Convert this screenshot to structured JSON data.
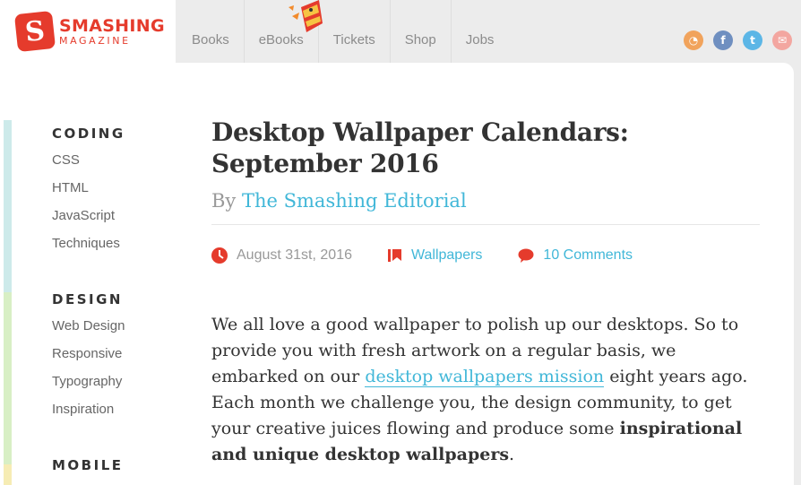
{
  "header": {
    "logo_title": "SMASHING",
    "logo_subtitle": "MAGAZINE",
    "logo_mark": "S",
    "nav": [
      "Books",
      "eBooks",
      "Tickets",
      "Shop",
      "Jobs"
    ],
    "social": [
      {
        "name": "rss-icon",
        "color": "#f1a35c",
        "glyph": "◔"
      },
      {
        "name": "facebook-icon",
        "color": "#6f8fc0",
        "glyph": "f"
      },
      {
        "name": "twitter-icon",
        "color": "#5cb6e6",
        "glyph": "t"
      },
      {
        "name": "newsletter-icon",
        "color": "#f3a6a0",
        "glyph": "✉"
      }
    ]
  },
  "sidebar": {
    "coding": {
      "title": "CODING",
      "links": [
        "CSS",
        "HTML",
        "JavaScript",
        "Techniques"
      ]
    },
    "design": {
      "title": "DESIGN",
      "links": [
        "Web Design",
        "Responsive",
        "Typography",
        "Inspiration"
      ]
    },
    "mobile": {
      "title": "MOBILE"
    }
  },
  "article": {
    "title_line1": "Desktop Wallpaper Calendars:",
    "title_line2": "September 2016",
    "by": "By",
    "author": "The Smashing Editorial",
    "date": "August 31st, 2016",
    "category": "Wallpapers",
    "comments": "10 Comments",
    "p_part1": "We all love a good wallpaper to polish up our desktops. So to provide you with fresh artwork on a regular basis, we embarked on our",
    "p_link": "desktop wallpapers mission",
    "p_part2": "eight years ago. Each month we challenge you, the design community, to get your creative juices flowing and produce some",
    "p_bold": "inspirational and unique desktop wallpapers",
    "p_end": "."
  },
  "colors": {
    "accent": "#41b7d8",
    "brand": "#e53b2c"
  }
}
